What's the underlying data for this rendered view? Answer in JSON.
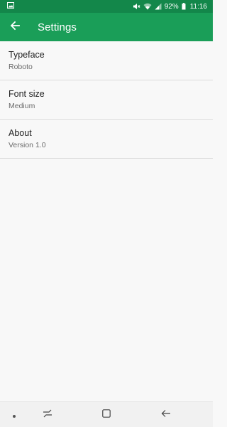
{
  "status_bar": {
    "battery_percent": "92%",
    "time": "11:16",
    "icons": [
      "image-notification-icon",
      "mute-icon",
      "wifi-icon",
      "signal-icon",
      "battery-icon"
    ]
  },
  "app_bar": {
    "title": "Settings",
    "back_icon": "arrow-back-icon"
  },
  "settings": {
    "items": [
      {
        "label": "Typeface",
        "value": "Roboto"
      },
      {
        "label": "Font size",
        "value": "Medium"
      },
      {
        "label": "About",
        "value": "Version 1.0"
      }
    ]
  },
  "nav_bar": {
    "icons": [
      "dot-icon",
      "recents-icon",
      "home-icon",
      "back-icon"
    ]
  },
  "colors": {
    "status_bar": "#13874a",
    "app_bar": "#1a9e58",
    "background": "#f8f8f8"
  }
}
